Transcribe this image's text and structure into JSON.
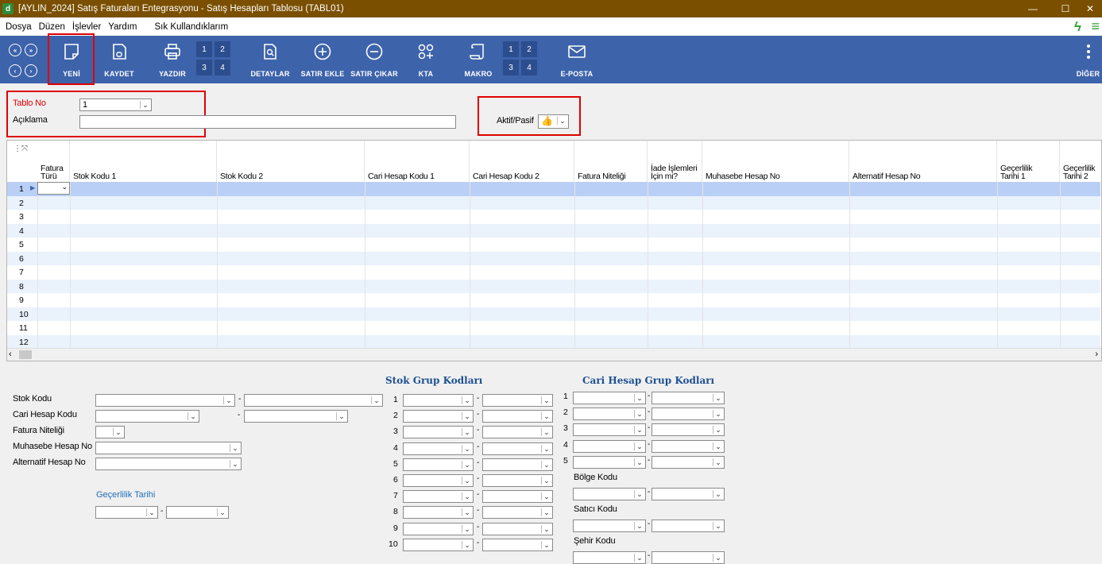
{
  "window": {
    "title": "[AYLIN_2024] Satış Faturaları Entegrasyonu - Satış Hesapları Tablosu (TABL01)",
    "app_icon": "d"
  },
  "menu": [
    "Dosya",
    "Düzen",
    "İşlevler",
    "Yardım",
    "Sık Kullandıklarım"
  ],
  "toolbar": {
    "yeni": "YENİ",
    "kaydet": "KAYDET",
    "yazdir": "YAZDIR",
    "detaylar": "DETAYLAR",
    "satir_ekle": "SATIR EKLE",
    "satir_cikar": "SATIR ÇIKAR",
    "kta": "KTA",
    "makro": "MAKRO",
    "eposta": "E-POSTA",
    "diger": "DİĞER",
    "grid1": [
      "1",
      "2",
      "3",
      "4"
    ],
    "grid2": [
      "1",
      "2",
      "3",
      "4"
    ]
  },
  "header": {
    "tablo_no_label": "Tablo No",
    "tablo_no_value": "1",
    "aciklama_label": "Açıklama",
    "aktif_pasif_label": "Aktif/Pasif"
  },
  "grid": {
    "columns": [
      {
        "l1": "Fatura",
        "l2": "Türü"
      },
      {
        "l1": "",
        "l2": "Stok Kodu 1"
      },
      {
        "l1": "",
        "l2": "Stok Kodu 2"
      },
      {
        "l1": "",
        "l2": "Cari Hesap Kodu 1"
      },
      {
        "l1": "",
        "l2": "Cari Hesap Kodu 2"
      },
      {
        "l1": "",
        "l2": "Fatura Niteliği"
      },
      {
        "l1": "İade İşlemleri",
        "l2": "İçin mi?"
      },
      {
        "l1": "",
        "l2": "Muhasebe Hesap No"
      },
      {
        "l1": "",
        "l2": "Alternatif Hesap No"
      },
      {
        "l1": "Geçerlilik",
        "l2": "Tarihi 1"
      },
      {
        "l1": "Geçerlilik",
        "l2": "Tarihi 2"
      }
    ],
    "rows": [
      "1",
      "2",
      "3",
      "4",
      "5",
      "6",
      "7",
      "8",
      "9",
      "10",
      "11",
      "12"
    ]
  },
  "bottom": {
    "stok_kodu": "Stok Kodu",
    "cari_hesap_kodu": "Cari Hesap Kodu",
    "fatura_niteligi": "Fatura  Niteliği",
    "muhasebe_hesap_no": "Muhasebe Hesap No",
    "alternatif_hesap_no": "Alternatif Hesap No",
    "gecerlilik_tarihi": "Geçerlilik Tarihi",
    "stok_grup_title": "Stok Grup Kodları",
    "cari_grup_title": "Cari Hesap Grup Kodları",
    "stok_grup_rows": [
      "1",
      "2",
      "3",
      "4",
      "5",
      "6",
      "7",
      "8",
      "9",
      "10"
    ],
    "cari_grup_rows": [
      "1",
      "2",
      "3",
      "4",
      "5"
    ],
    "bolge_kodu": "Bölge Kodu",
    "satici_kodu": "Satıcı Kodu",
    "sehir_kodu": "Şehir Kodu",
    "dash": "-"
  },
  "colors": {
    "titlebar": "#7a4f00",
    "toolbar": "#3d63ab",
    "highlight": "#e00000",
    "selected_row": "#b9cff5",
    "alt_row": "#eaf2fc"
  }
}
